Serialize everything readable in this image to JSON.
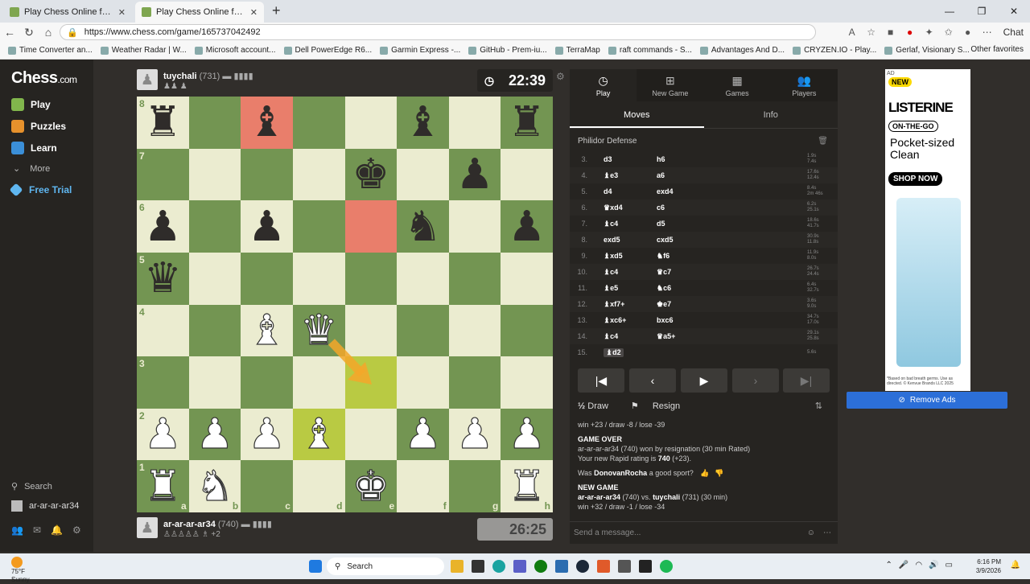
{
  "browser": {
    "tabs": [
      {
        "title": "Play Chess Online for FREE - 2 Pla",
        "active": false
      },
      {
        "title": "Play Chess Online for FREE - 2 Pla",
        "active": true
      }
    ],
    "url": "https://www.chess.com/game/165737042492",
    "chat_label": "Chat",
    "bookmarks": [
      "Time Converter an...",
      "Weather Radar | W...",
      "Microsoft account...",
      "Dell PowerEdge R6...",
      "Garmin Express -...",
      "GitHub - Prem-iu...",
      "TerraMap",
      "raft commands - S...",
      "Advantages And D...",
      "CRYZEN.IO - Play...",
      "Gerlaf, Visionary S..."
    ],
    "other_favorites": "Other favorites"
  },
  "sidebar": {
    "logo": "Chess",
    "logo_suffix": ".com",
    "items": [
      "Play",
      "Puzzles",
      "Learn",
      "More",
      "Free Trial"
    ],
    "search": "Search",
    "user": "ar-ar-ar-ar34"
  },
  "top_player": {
    "name": "tuychali",
    "rating": "(731)",
    "clock": "22:39"
  },
  "bottom_player": {
    "name": "ar-ar-ar-ar34",
    "rating": "(740)",
    "extra": "+2",
    "clock": "26:25"
  },
  "board": {
    "ranks": [
      "8",
      "7",
      "6",
      "5",
      "4",
      "3",
      "2",
      "1"
    ],
    "files": [
      "a",
      "b",
      "c",
      "d",
      "e",
      "f",
      "g",
      "h"
    ],
    "position": [
      [
        "bR",
        "",
        "bB",
        "",
        "",
        "bB",
        "",
        "bR"
      ],
      [
        "",
        "",
        "",
        "",
        "bK",
        "",
        "bP",
        ""
      ],
      [
        "bP",
        "",
        "bP",
        "",
        "",
        "bN",
        "",
        "bP"
      ],
      [
        "bQ",
        "",
        "",
        "",
        "",
        "",
        "",
        ""
      ],
      [
        "",
        "",
        "wB",
        "wQ",
        "",
        "",
        "",
        ""
      ],
      [
        "",
        "",
        "",
        "",
        "",
        "",
        "",
        ""
      ],
      [
        "wP",
        "wP",
        "wP",
        "wB",
        "",
        "wP",
        "wP",
        "wP"
      ],
      [
        "wR",
        "wN",
        "",
        "",
        "wK",
        "",
        "",
        "wR"
      ]
    ],
    "highlight_red": [
      "c8",
      "e6"
    ],
    "highlight_yellow": [
      "e3",
      "d2"
    ]
  },
  "panel": {
    "tabs": [
      {
        "label": "Play",
        "icon": "play-clock-icon"
      },
      {
        "label": "New Game",
        "icon": "new-game-icon"
      },
      {
        "label": "Games",
        "icon": "games-icon"
      },
      {
        "label": "Players",
        "icon": "players-icon"
      }
    ],
    "subtabs": [
      "Moves",
      "Info"
    ],
    "opening": "Philidor Defense",
    "moves": [
      {
        "n": "3.",
        "w": "d3",
        "b": "h6",
        "tw": "1.9s",
        "tb": "7.4s"
      },
      {
        "n": "4.",
        "w": "♝e3",
        "b": "a6",
        "tw": "17.6s",
        "tb": "12.4s"
      },
      {
        "n": "5.",
        "w": "d4",
        "b": "exd4",
        "tw": "8.4s",
        "tb": "2m 46s"
      },
      {
        "n": "6.",
        "w": "♛xd4",
        "b": "c6",
        "tw": "6.2s",
        "tb": "25.1s"
      },
      {
        "n": "7.",
        "w": "♝c4",
        "b": "d5",
        "tw": "18.6s",
        "tb": "41.7s"
      },
      {
        "n": "8.",
        "w": "exd5",
        "b": "cxd5",
        "tw": "30.9s",
        "tb": "11.8s"
      },
      {
        "n": "9.",
        "w": "♝xd5",
        "b": "♞f6",
        "tw": "11.9s",
        "tb": "8.0s"
      },
      {
        "n": "10.",
        "w": "♝c4",
        "b": "♛c7",
        "tw": "26.7s",
        "tb": "24.4s"
      },
      {
        "n": "11.",
        "w": "♝e5",
        "b": "♞c6",
        "tw": "6.4s",
        "tb": "32.7s"
      },
      {
        "n": "12.",
        "w": "♝xf7+",
        "b": "♚e7",
        "tw": "3.6s",
        "tb": "9.0s"
      },
      {
        "n": "13.",
        "w": "♝xc6+",
        "b": "bxc6",
        "tw": "34.7s",
        "tb": "17.0s"
      },
      {
        "n": "14.",
        "w": "♝c4",
        "b": "♛a5+",
        "tw": "29.1s",
        "tb": "25.8s"
      },
      {
        "n": "15.",
        "w": "♝d2",
        "b": "",
        "tw": "5.6s",
        "tb": ""
      }
    ],
    "actions": {
      "draw": "Draw",
      "draw_prefix": "½",
      "resign": "Resign"
    },
    "chat": {
      "line0": "win +23 / draw -8 / lose -39",
      "game_over": "GAME OVER",
      "result": "ar-ar-ar-ar34 (740) won by resignation (30 min Rated)",
      "rating_prefix": "Your new Rapid rating is ",
      "rating_value": "740",
      "rating_delta": " (+23).",
      "sport_q_pre": "Was ",
      "sport_q_name": "DonovanRocha",
      "sport_q_post": " a good sport?",
      "new_game": "NEW GAME",
      "ng_white": "ar-ar-ar-ar34",
      "ng_white_rating": " (740) vs. ",
      "ng_black": "tuychali",
      "ng_black_rating": " (731) (30 min)",
      "ng_stats": "win +32 / draw -1 / lose -34"
    },
    "send_placeholder": "Send a message..."
  },
  "ad": {
    "ad_label": "AD",
    "badge": "NEW",
    "brand": "LISTERINE",
    "on_the_go": "ON-THE-GO",
    "tagline": "Pocket-sized Clean",
    "cta": "SHOP NOW",
    "fine_print": "*Based on bad breath germs. Use as directed. © Kenvue Brands LLC 2025",
    "remove_ads": "Remove Ads"
  },
  "taskbar": {
    "temp": "75°F",
    "condition": "Sunny",
    "search": "Search",
    "time": "6:16 PM",
    "date": "3/9/2026"
  }
}
